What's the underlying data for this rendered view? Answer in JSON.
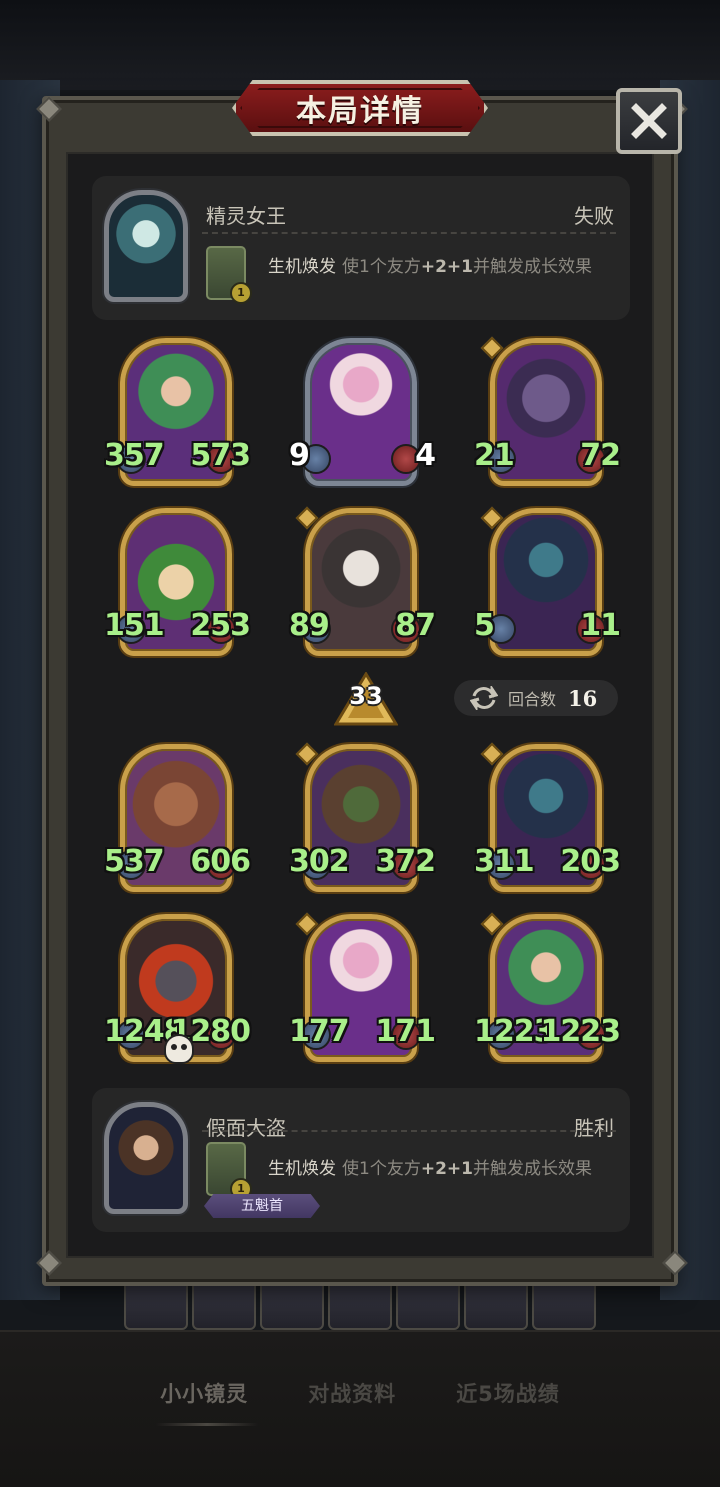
{
  "title": "本局详情",
  "top_player": {
    "name": "精灵女王",
    "result": "失败",
    "skill_name": "生机焕发",
    "skill_desc_pre": "使1个友方",
    "skill_desc_bold": "+2+1",
    "skill_desc_post": "并触发成长效果",
    "skill_level": "1"
  },
  "bottom_player": {
    "name": "假面大盗",
    "result": "胜利",
    "skill_name": "生机焕发",
    "skill_desc_pre": "使1个友方",
    "skill_desc_bold": "+2+1",
    "skill_desc_post": "并触发成长效果",
    "skill_level": "1",
    "badge": "五魁首"
  },
  "top_board": [
    {
      "atk": "357",
      "hp": "573",
      "frame": "gold",
      "art": "fairy"
    },
    {
      "atk": "9",
      "hp": "4",
      "frame": "silver",
      "art": "doll"
    },
    {
      "atk": "21",
      "hp": "72",
      "frame": "gold",
      "art": "octo"
    },
    {
      "atk": "151",
      "hp": "253",
      "frame": "gold",
      "art": "sprout"
    },
    {
      "atk": "89",
      "hp": "87",
      "frame": "gold",
      "art": "rabbit"
    },
    {
      "atk": "5",
      "hp": "11",
      "frame": "gold",
      "art": "elf"
    }
  ],
  "bottom_board": [
    {
      "atk": "537",
      "hp": "606",
      "frame": "gold",
      "art": "treant"
    },
    {
      "atk": "302",
      "hp": "372",
      "frame": "gold",
      "art": "goblin"
    },
    {
      "atk": "311",
      "hp": "203",
      "frame": "gold",
      "art": "elf"
    },
    {
      "atk": "1248",
      "hp": "1280",
      "frame": "gold",
      "art": "beast"
    },
    {
      "atk": "177",
      "hp": "171",
      "frame": "gold",
      "art": "doll"
    },
    {
      "atk": "1223",
      "hp": "1223",
      "frame": "gold",
      "art": "fairy"
    }
  ],
  "tier": "33",
  "round_label": "回合数",
  "round_value": "16",
  "tabs": [
    "小小镜灵",
    "对战资料",
    "近5场战绩"
  ],
  "colors": {
    "stat_green": "#a9ef8a",
    "frame_gold": "#c9a04a",
    "title_red": "#8b1d1d"
  }
}
